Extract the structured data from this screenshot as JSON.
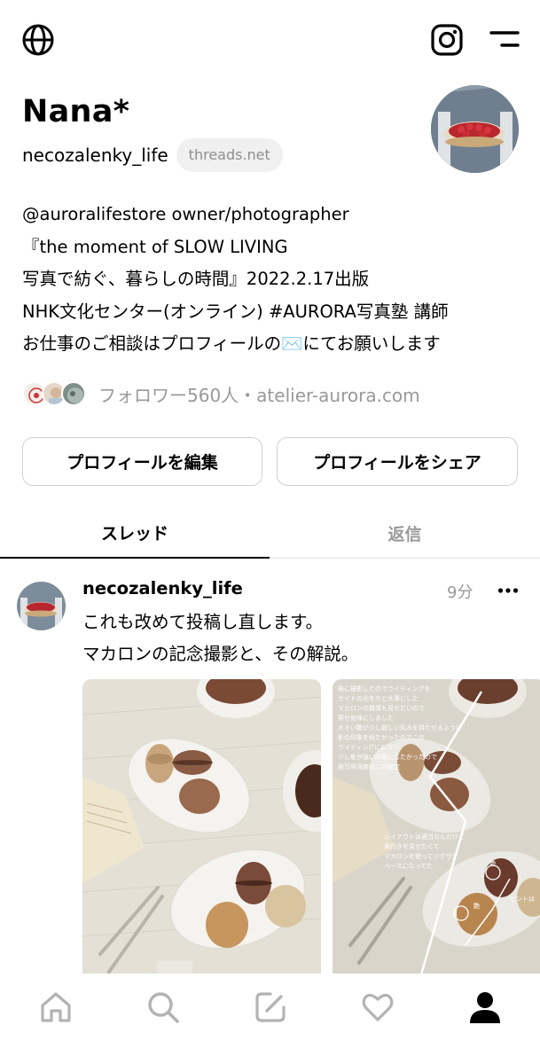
{
  "topbar": {
    "globe_icon": "globe-icon",
    "instagram_icon": "instagram-icon",
    "menu_icon": "menu-icon"
  },
  "profile": {
    "name": "Nana*",
    "handle": "necozalenky_life",
    "domain": "threads.net",
    "bio_lines": [
      "@auroralifestore owner/photographer",
      "『the moment of SLOW LIVING",
      "写真で紡ぐ、暮らしの時間』2022.2.17出版",
      "NHK文化センター(オンライン) #AURORA写真塾 講師",
      "お仕事のご相談はプロフィールの✉️にてお願いします"
    ],
    "followers_text": "フォロワー560人・atelier-aurora.com"
  },
  "buttons": {
    "edit": "プロフィールを編集",
    "share": "プロフィールをシェア"
  },
  "tabs": {
    "threads": "スレッド",
    "replies": "返信"
  },
  "post": {
    "username": "necozalenky_life",
    "time": "9分",
    "text_lines": [
      "これも改めて投稿し直します。",
      "マカロンの記念撮影と、その解説。"
    ],
    "photo2_annotations": {
      "top_block": [
        "後に撮影したのでライティングを",
        "サイドの光をちと大事にした",
        "マカロンの質感も見せたいので",
        "寄せ気味にしました",
        "大きい艶が少し欲しい丸みを持たせるように",
        "影の印象を似たかったのでこの",
        "ライティングにしつつ、",
        "少し影が強い印象にしたかったので",
        "被写界深度はこの設定"
      ],
      "mid_block": [
        "レイアウトは適当なんだけど",
        "奥行きを見せたくて",
        "マカロンを使ってジグザグ",
        "ベースになってた"
      ],
      "label_gloss1": "艶",
      "label_gloss2": "艶",
      "label_hint": "ヒントは"
    }
  },
  "bottom_nav": [
    "home-icon",
    "search-icon",
    "compose-icon",
    "heart-icon",
    "profile-icon"
  ],
  "colors": {
    "muted": "#999999",
    "pill_bg": "#f0f0f0",
    "border": "#d0d0d0"
  }
}
